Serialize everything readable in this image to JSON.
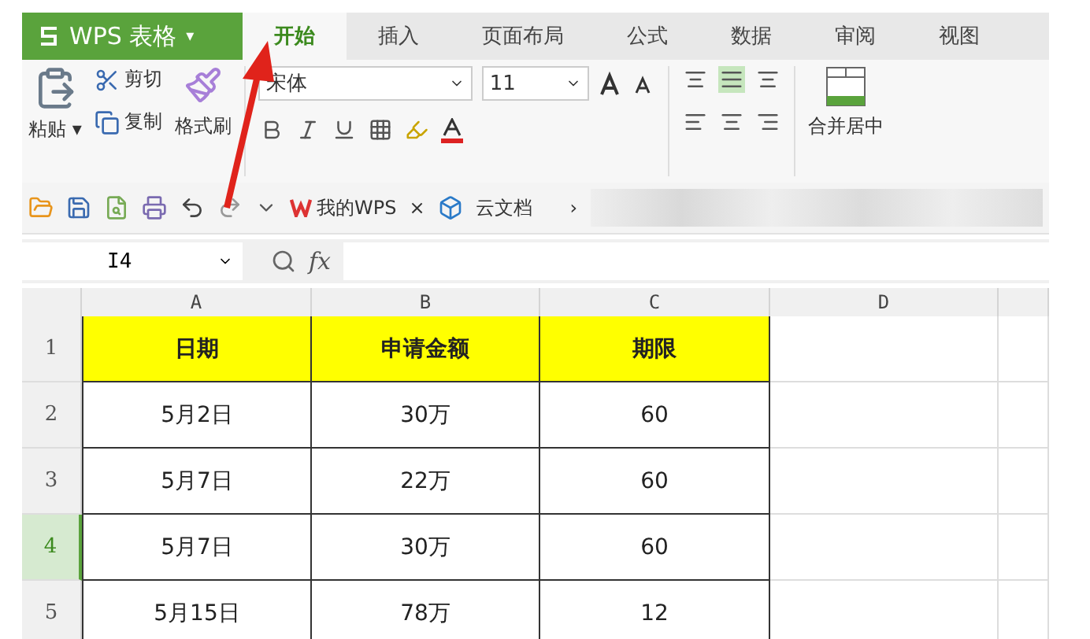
{
  "app_menu": {
    "label": "WPS 表格",
    "caret": "▾"
  },
  "menu_tabs": [
    {
      "label": "开始",
      "selected": true
    },
    {
      "label": "插入",
      "selected": false
    },
    {
      "label": "页面布局",
      "selected": false
    },
    {
      "label": "公式",
      "selected": false
    },
    {
      "label": "数据",
      "selected": false
    },
    {
      "label": "审阅",
      "selected": false
    },
    {
      "label": "视图",
      "selected": false
    }
  ],
  "ribbon": {
    "paste": "粘贴",
    "paste_caret": "▾",
    "cut": "剪切",
    "copy": "复制",
    "format_painter": "格式刷",
    "font_name": "宋体",
    "font_size": "11",
    "merge_center": "合并居中",
    "align_center_selected": true
  },
  "quick_access": {
    "doc_tabs": [
      {
        "label": "我的WPS",
        "close": "×"
      },
      {
        "label": "云文档"
      }
    ],
    "more": "›"
  },
  "formula_bar": {
    "name_box": "I4",
    "fx": "fx"
  },
  "sheet": {
    "columns": [
      "A",
      "B",
      "C",
      "D"
    ],
    "rows": [
      {
        "number": "1",
        "selected": false,
        "header": true,
        "cells": [
          "日期",
          "申请金额",
          "期限"
        ]
      },
      {
        "number": "2",
        "selected": false,
        "header": false,
        "cells": [
          "5月2日",
          "30万",
          "60"
        ]
      },
      {
        "number": "3",
        "selected": false,
        "header": false,
        "cells": [
          "5月7日",
          "22万",
          "60"
        ]
      },
      {
        "number": "4",
        "selected": true,
        "header": false,
        "cells": [
          "5月7日",
          "30万",
          "60"
        ]
      },
      {
        "number": "5",
        "selected": false,
        "header": false,
        "cells": [
          "5月15日",
          "78万",
          "12"
        ]
      }
    ]
  }
}
